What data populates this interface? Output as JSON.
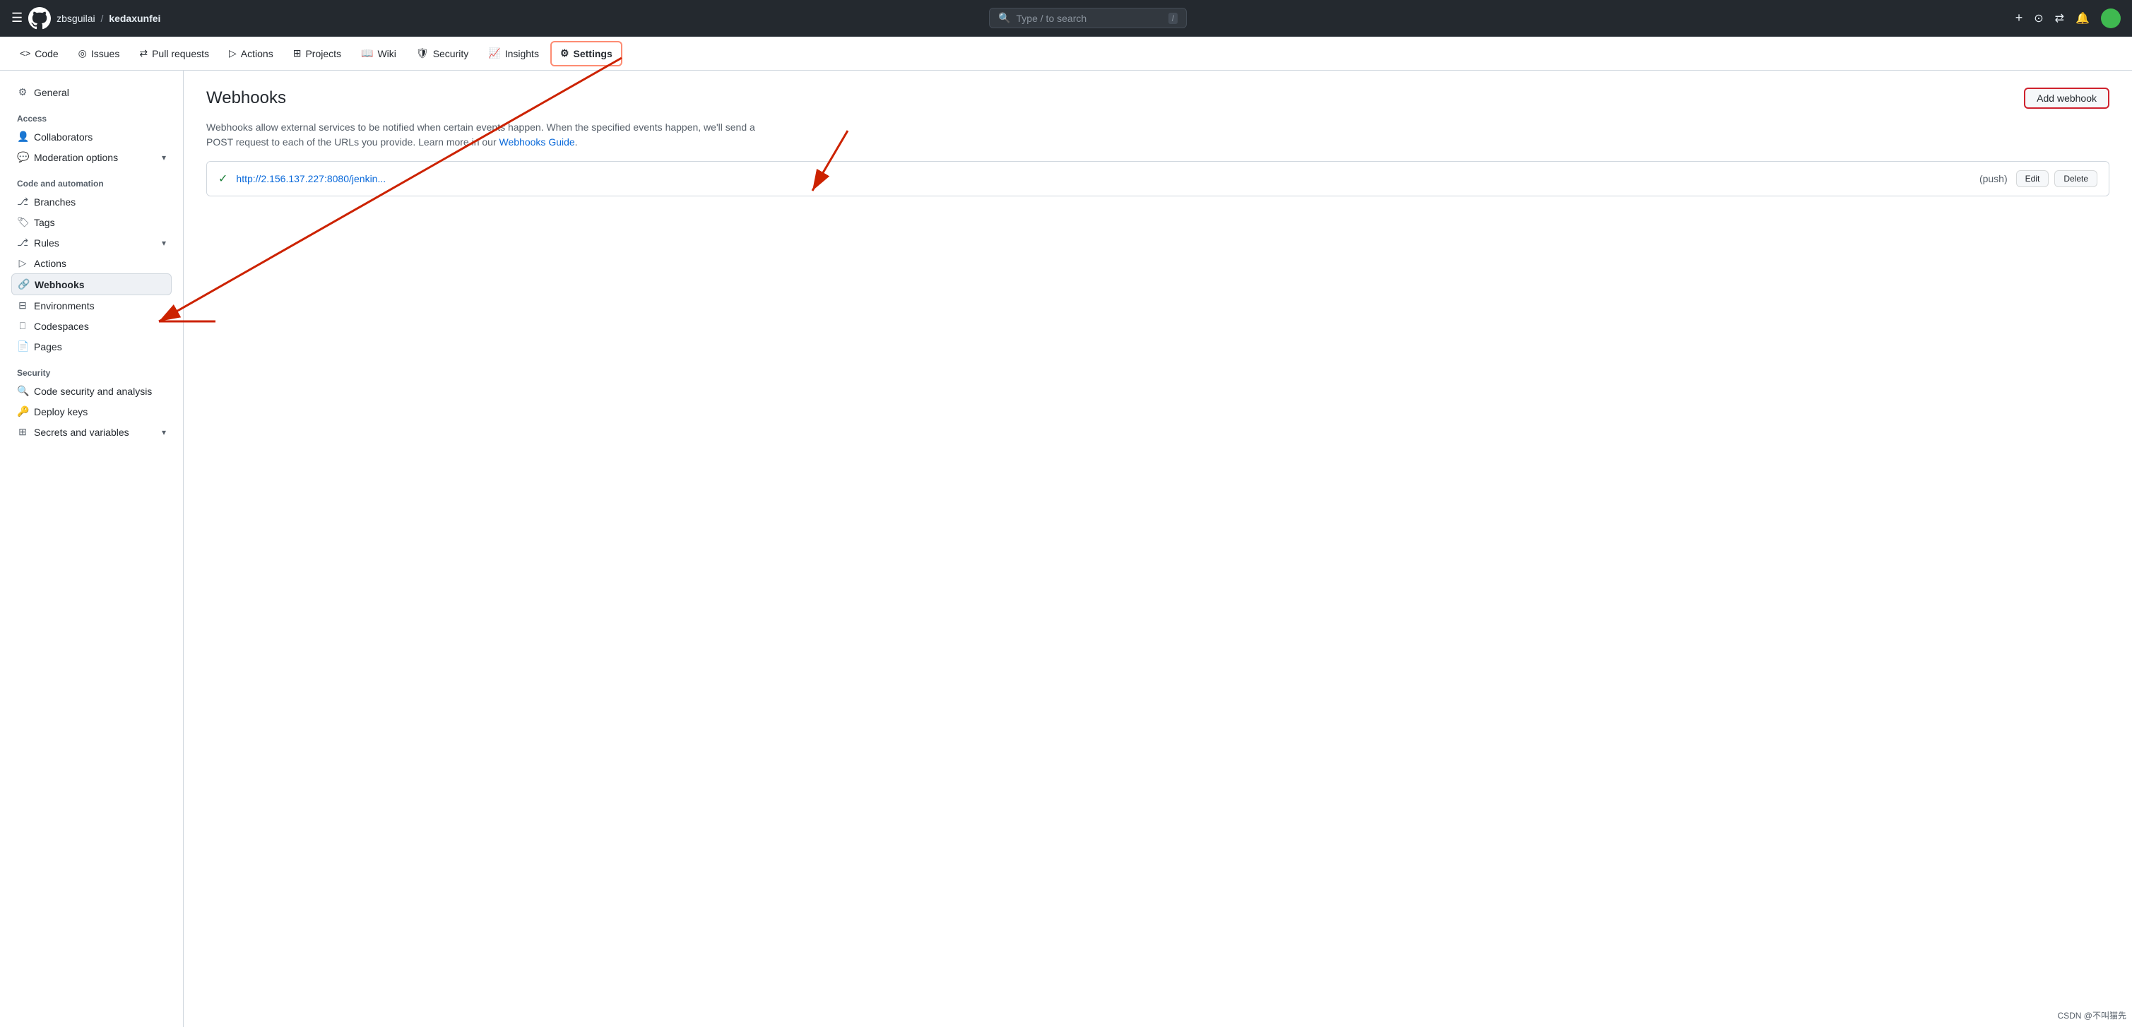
{
  "topbar": {
    "hamburger": "☰",
    "repo_owner": "zbsguilai",
    "repo_sep": "/",
    "repo_name": "kedaxunfei",
    "search_placeholder": "Type / to search",
    "search_icon": "🔍",
    "search_slash": "/",
    "plus_icon": "+",
    "circle_icon": "⊙",
    "git_icon": "⇄",
    "inbox_icon": "🔔",
    "avatar_icon": "🟢"
  },
  "nav": {
    "items": [
      {
        "id": "code",
        "icon": "<>",
        "label": "Code",
        "active": false
      },
      {
        "id": "issues",
        "icon": "◎",
        "label": "Issues",
        "active": false
      },
      {
        "id": "pull-requests",
        "icon": "⇄",
        "label": "Pull requests",
        "active": false
      },
      {
        "id": "actions",
        "icon": "▷",
        "label": "Actions",
        "active": false
      },
      {
        "id": "projects",
        "icon": "⊞",
        "label": "Projects",
        "active": false
      },
      {
        "id": "wiki",
        "icon": "📖",
        "label": "Wiki",
        "active": false
      },
      {
        "id": "security",
        "icon": "🛡",
        "label": "Security",
        "active": false
      },
      {
        "id": "insights",
        "icon": "📈",
        "label": "Insights",
        "active": false
      },
      {
        "id": "settings",
        "icon": "⚙",
        "label": "Settings",
        "active": true
      }
    ]
  },
  "sidebar": {
    "general_label": "General",
    "access_section": "Access",
    "collaborators_label": "Collaborators",
    "moderation_label": "Moderation options",
    "code_automation_section": "Code and automation",
    "branches_label": "Branches",
    "tags_label": "Tags",
    "rules_label": "Rules",
    "actions_label": "Actions",
    "webhooks_label": "Webhooks",
    "environments_label": "Environments",
    "codespaces_label": "Codespaces",
    "pages_label": "Pages",
    "security_section": "Security",
    "code_security_label": "Code security and analysis",
    "deploy_keys_label": "Deploy keys",
    "secrets_label": "Secrets and variables"
  },
  "main": {
    "title": "Webhooks",
    "add_button": "Add webhook",
    "description_part1": "Webhooks allow external services to be notified when certain events happen. When the specified events happen, we'll send a POST request to each of the URLs you provide. Learn more in our ",
    "description_link_text": "Webhooks Guide",
    "description_part2": ".",
    "webhook": {
      "url": "http://2.156.137.227:8080/jenkin...",
      "event": "(push)",
      "edit_btn": "Edit",
      "delete_btn": "Delete"
    }
  },
  "watermark": "CSDN @不叫猫先"
}
